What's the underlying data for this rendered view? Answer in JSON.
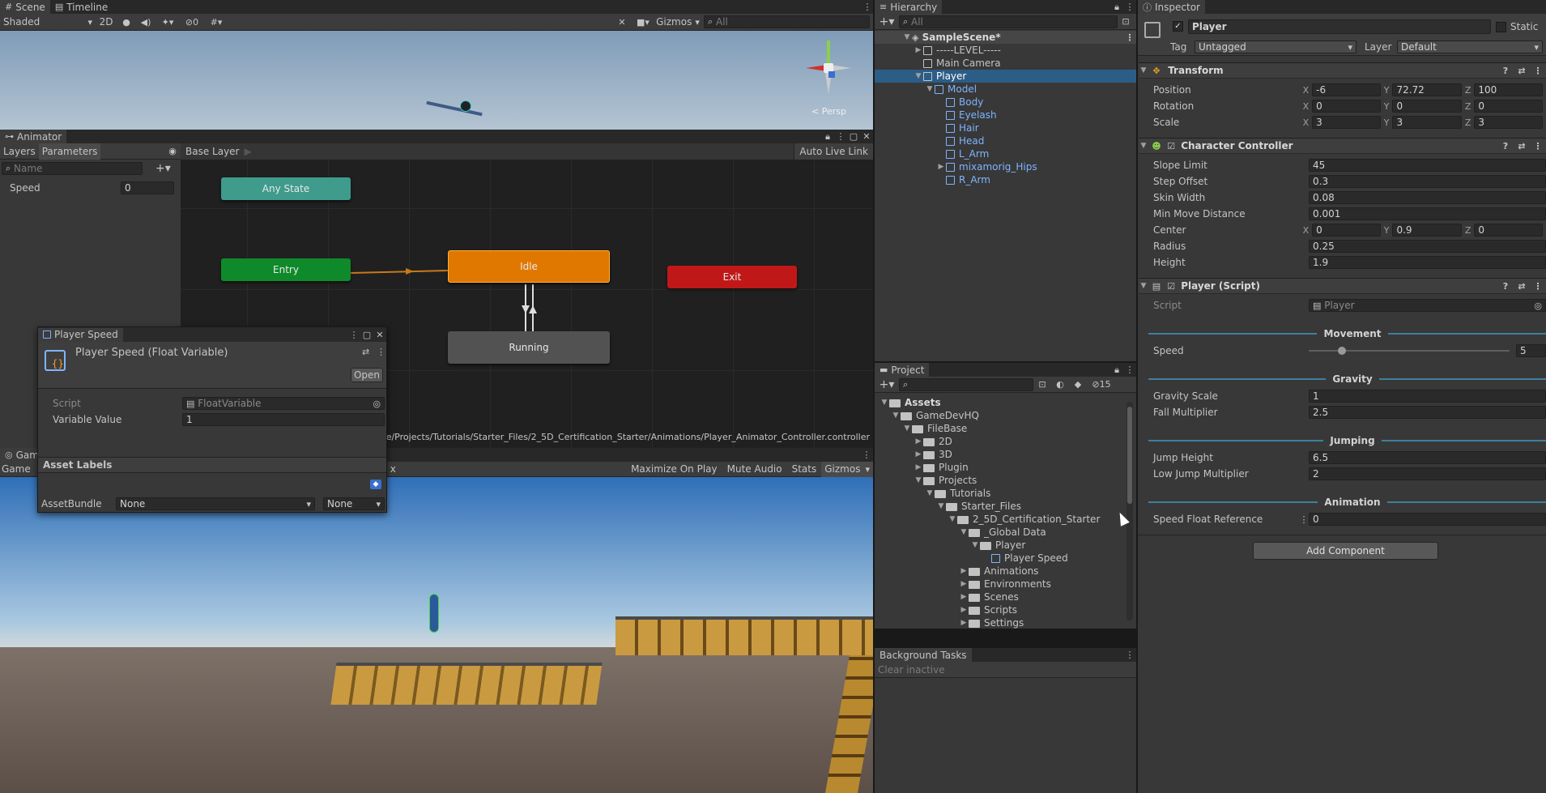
{
  "scene": {
    "tabs": [
      {
        "label": "Scene",
        "icon": "grid-icon"
      },
      {
        "label": "Timeline",
        "icon": "film-icon"
      }
    ],
    "shading": "Shaded",
    "mode_2d": "2D",
    "hidden_count": "0",
    "gizmos": "Gizmos",
    "search_placeholder": "All",
    "persp": "< Persp"
  },
  "animator": {
    "title": "Animator",
    "tabs": [
      "Layers",
      "Parameters"
    ],
    "breadcrumb": "Base Layer",
    "auto_live_link": "Auto Live Link",
    "search_placeholder": "Name",
    "params": [
      {
        "name": "Speed",
        "value": "0"
      }
    ],
    "nodes": {
      "any_state": "Any State",
      "entry": "Entry",
      "idle": "Idle",
      "exit": "Exit",
      "running": "Running"
    },
    "path": "s/GameDevHQ/FileBase/Projects/Tutorials/Starter_Files/2_5D_Certification_Starter/Animations/Player_Animator_Controller.controller"
  },
  "popup": {
    "title": "Player Speed",
    "subtitle": "Player Speed (Float Variable)",
    "open": "Open",
    "script_label": "Script",
    "script_value": "FloatVariable",
    "var_label": "Variable Value",
    "var_value": "1",
    "asset_labels": "Asset Labels",
    "assetbundle_label": "AssetBundle",
    "bundle_a": "None",
    "bundle_b": "None"
  },
  "game": {
    "tab": "Game",
    "game_label": "Game",
    "x_label": "x",
    "maximize": "Maximize On Play",
    "mute": "Mute Audio",
    "stats": "Stats",
    "gizmos": "Gizmos"
  },
  "hierarchy": {
    "title": "Hierarchy",
    "search_placeholder": "All",
    "scene_name": "SampleScene*",
    "items": [
      {
        "label": "-----LEVEL-----",
        "depth": 1,
        "expander": "▶",
        "prefab": false
      },
      {
        "label": "Main Camera",
        "depth": 1,
        "expander": "",
        "prefab": false
      },
      {
        "label": "Player",
        "depth": 1,
        "expander": "▼",
        "prefab": false,
        "selected": true
      },
      {
        "label": "Model",
        "depth": 2,
        "expander": "▼",
        "prefab": true
      },
      {
        "label": "Body",
        "depth": 3,
        "expander": "",
        "prefab": true
      },
      {
        "label": "Eyelash",
        "depth": 3,
        "expander": "",
        "prefab": true
      },
      {
        "label": "Hair",
        "depth": 3,
        "expander": "",
        "prefab": true
      },
      {
        "label": "Head",
        "depth": 3,
        "expander": "",
        "prefab": true
      },
      {
        "label": "L_Arm",
        "depth": 3,
        "expander": "",
        "prefab": true
      },
      {
        "label": "mixamorig_Hips",
        "depth": 3,
        "expander": "▶",
        "prefab": true
      },
      {
        "label": "R_Arm",
        "depth": 3,
        "expander": "",
        "prefab": true
      }
    ]
  },
  "project": {
    "title": "Project",
    "hidden_count": "15",
    "items": [
      {
        "label": "Assets",
        "depth": 0,
        "expander": "▼",
        "type": "folder",
        "bold": true
      },
      {
        "label": "GameDevHQ",
        "depth": 1,
        "expander": "▼",
        "type": "folder"
      },
      {
        "label": "FileBase",
        "depth": 2,
        "expander": "▼",
        "type": "folder"
      },
      {
        "label": "2D",
        "depth": 3,
        "expander": "▶",
        "type": "folder"
      },
      {
        "label": "3D",
        "depth": 3,
        "expander": "▶",
        "type": "folder"
      },
      {
        "label": "Plugin",
        "depth": 3,
        "expander": "▶",
        "type": "folder"
      },
      {
        "label": "Projects",
        "depth": 3,
        "expander": "▼",
        "type": "folder"
      },
      {
        "label": "Tutorials",
        "depth": 4,
        "expander": "▼",
        "type": "folder"
      },
      {
        "label": "Starter_Files",
        "depth": 5,
        "expander": "▼",
        "type": "folder"
      },
      {
        "label": "2_5D_Certification_Starter",
        "depth": 6,
        "expander": "▼",
        "type": "folder"
      },
      {
        "label": "_Global Data",
        "depth": 7,
        "expander": "▼",
        "type": "folder"
      },
      {
        "label": "Player",
        "depth": 8,
        "expander": "▼",
        "type": "folder"
      },
      {
        "label": "Player Speed",
        "depth": 9,
        "expander": "",
        "type": "asset"
      },
      {
        "label": "Animations",
        "depth": 7,
        "expander": "▶",
        "type": "folder"
      },
      {
        "label": "Environments",
        "depth": 7,
        "expander": "▶",
        "type": "folder"
      },
      {
        "label": "Scenes",
        "depth": 7,
        "expander": "▶",
        "type": "folder"
      },
      {
        "label": "Scripts",
        "depth": 7,
        "expander": "▶",
        "type": "folder"
      },
      {
        "label": "Settings",
        "depth": 7,
        "expander": "▶",
        "type": "folder"
      }
    ]
  },
  "background_tasks": {
    "title": "Background Tasks",
    "clear": "Clear inactive"
  },
  "inspector": {
    "title": "Inspector",
    "object_name": "Player",
    "static": "Static",
    "tag_label": "Tag",
    "tag": "Untagged",
    "layer_label": "Layer",
    "layer": "Default",
    "transform": {
      "title": "Transform",
      "position": {
        "label": "Position",
        "x": "-6",
        "y": "72.72",
        "z": "100"
      },
      "rotation": {
        "label": "Rotation",
        "x": "0",
        "y": "0",
        "z": "0"
      },
      "scale": {
        "label": "Scale",
        "x": "3",
        "y": "3",
        "z": "3"
      }
    },
    "cc": {
      "title": "Character Controller",
      "slope_limit": {
        "label": "Slope Limit",
        "value": "45"
      },
      "step_offset": {
        "label": "Step Offset",
        "value": "0.3"
      },
      "skin_width": {
        "label": "Skin Width",
        "value": "0.08"
      },
      "min_move": {
        "label": "Min Move Distance",
        "value": "0.001"
      },
      "center": {
        "label": "Center",
        "x": "0",
        "y": "0.9",
        "z": "0"
      },
      "radius": {
        "label": "Radius",
        "value": "0.25"
      },
      "height": {
        "label": "Height",
        "value": "1.9"
      }
    },
    "script": {
      "title": "Player (Script)",
      "script_label": "Script",
      "script_value": "Player",
      "movement": "Movement",
      "speed_label": "Speed",
      "speed_value": "5",
      "speed_fraction": 0.15,
      "gravity": "Gravity",
      "gravity_scale_label": "Gravity Scale",
      "gravity_scale": "1",
      "fall_mult_label": "Fall Multiplier",
      "fall_mult": "2.5",
      "jumping": "Jumping",
      "jump_height_label": "Jump Height",
      "jump_height": "6.5",
      "low_jump_label": "Low Jump Multiplier",
      "low_jump": "2",
      "animation": "Animation",
      "speed_ref_label": "Speed Float Reference",
      "speed_ref": "0"
    },
    "add_component": "Add Component"
  },
  "colors": {
    "accent": "#2c5d87",
    "entry": "#0f8a2a",
    "idle": "#e07800",
    "exit": "#c01818",
    "any": "#3f9b8c"
  }
}
